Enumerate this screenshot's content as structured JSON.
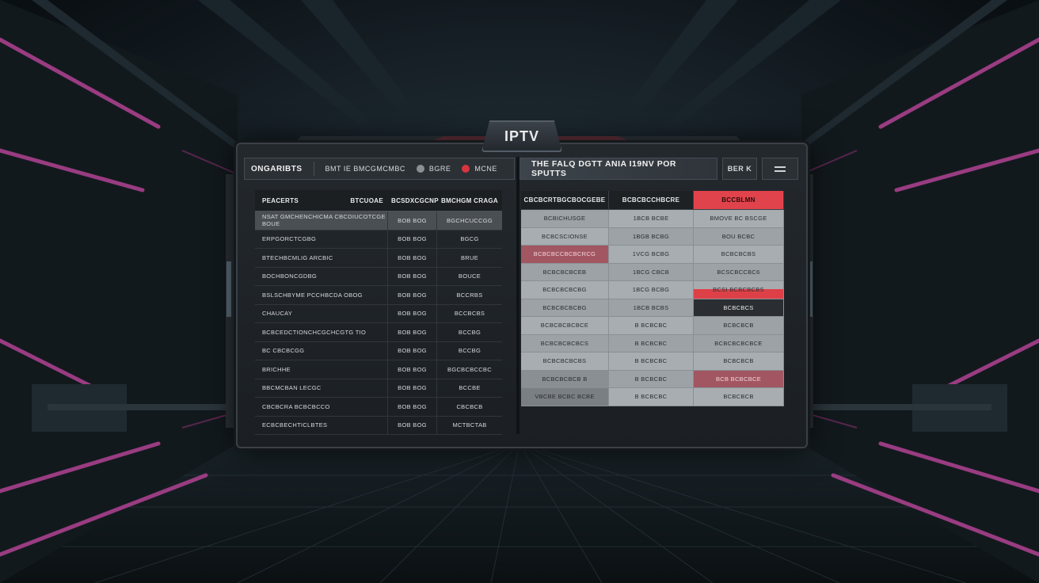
{
  "app": {
    "title": "IPTV"
  },
  "top_bar": {
    "brand": "ONGARIBTS",
    "item1": "BMT IE BMCGMCMBC",
    "item2": "BGRE",
    "item3": "MCNE",
    "banner": "THE FALQ DGTT ANIA I19NV POR SPUTTS",
    "close_label": "BER K",
    "menu_icon": "hamburger-icon"
  },
  "left_table": {
    "headers": [
      "PEACERTS",
      "BTCUOAE",
      "BCS",
      "DXCGCNP",
      "BMCHGM CRAGA"
    ],
    "rows": [
      [
        "NSAT GMCHENCHICMA CBCDIUCOTCGE BOUE",
        "BOB BOG",
        "BGCHCUCCGG"
      ],
      [
        "ERPGORCTCGBG",
        "BOB BOG",
        "BGCG"
      ],
      [
        "BTECHBCMLIG ARCBIC",
        "BOB BOG",
        "BRUE"
      ],
      [
        "BOCHBONCGDBG",
        "BOB BOG",
        "BOUCE"
      ],
      [
        "BSLSCHBYME PCCHBCDA OBOG",
        "BOB BOG",
        "BCCRBS"
      ],
      [
        "CHAUCAY",
        "BOB BOG",
        "BCCBCBS"
      ],
      [
        "BCBCEDCTIONCHCGCHCGTG TIO",
        "BOB BOG",
        "BCCBG"
      ],
      [
        "BC CBCBCGG",
        "BOB BOG",
        "BCCBG"
      ],
      [
        "BRICHHE",
        "BOB BOG",
        "BGCBCBCCBC"
      ],
      [
        "BBCMCBAN LECGC",
        "BOB BOG",
        "BCCBE"
      ],
      [
        "CBCBCRA BCBCBCCO",
        "BOB BOG",
        "CBCBCB"
      ],
      [
        "ECBCBECHTICLBTES",
        "BOB BOG",
        "MCTBCTAB"
      ]
    ]
  },
  "right_table": {
    "headers": [
      "CBCBCRTBGCBOCGEBE",
      "BCBCBCCHBCRE",
      "BCCBLMN"
    ],
    "rows": [
      [
        "BCBICHUSGE",
        "1BCB BCBE",
        "BMOVE BC BSCGE"
      ],
      [
        "BCBCSCIONSE",
        "1BGB BCBG",
        "BOU BCBC"
      ],
      [
        "BCBCBCCBCBCRCG",
        "1VCG BCBG",
        "BCBCBCBS"
      ],
      [
        "BCBCBCBCEB",
        "1BCG CBCB",
        "BCSCBCCBC6"
      ],
      [
        "BCBCBCBCBG",
        "1BCG BCBG",
        "BCSI BCBCBCBS"
      ],
      [
        "BCBCBCBCBG",
        "1BCB BCBS",
        "BCBCBCS"
      ],
      [
        "BCBCBCBCBCE",
        "B BCBCBC",
        "BCBCBCB"
      ],
      [
        "BCBCBCBCBCS",
        "B BCBCBC",
        "BCBCBCBCBCE"
      ],
      [
        "BCBCBCBCBS",
        "B BCBCBC",
        "BCBCBCB"
      ],
      [
        "BCBCBCBCB B",
        "B BCBCBC",
        "BCB BCBCBCE"
      ],
      [
        "VBCBE BCBC BCBE",
        "B BCBCBC",
        "BCBCBCB"
      ]
    ]
  },
  "colors": {
    "accent_red": "#e0434b",
    "accent_rose": "#a25662",
    "neon_magenta": "#b0408e",
    "panel_bg": "#1d2125"
  }
}
